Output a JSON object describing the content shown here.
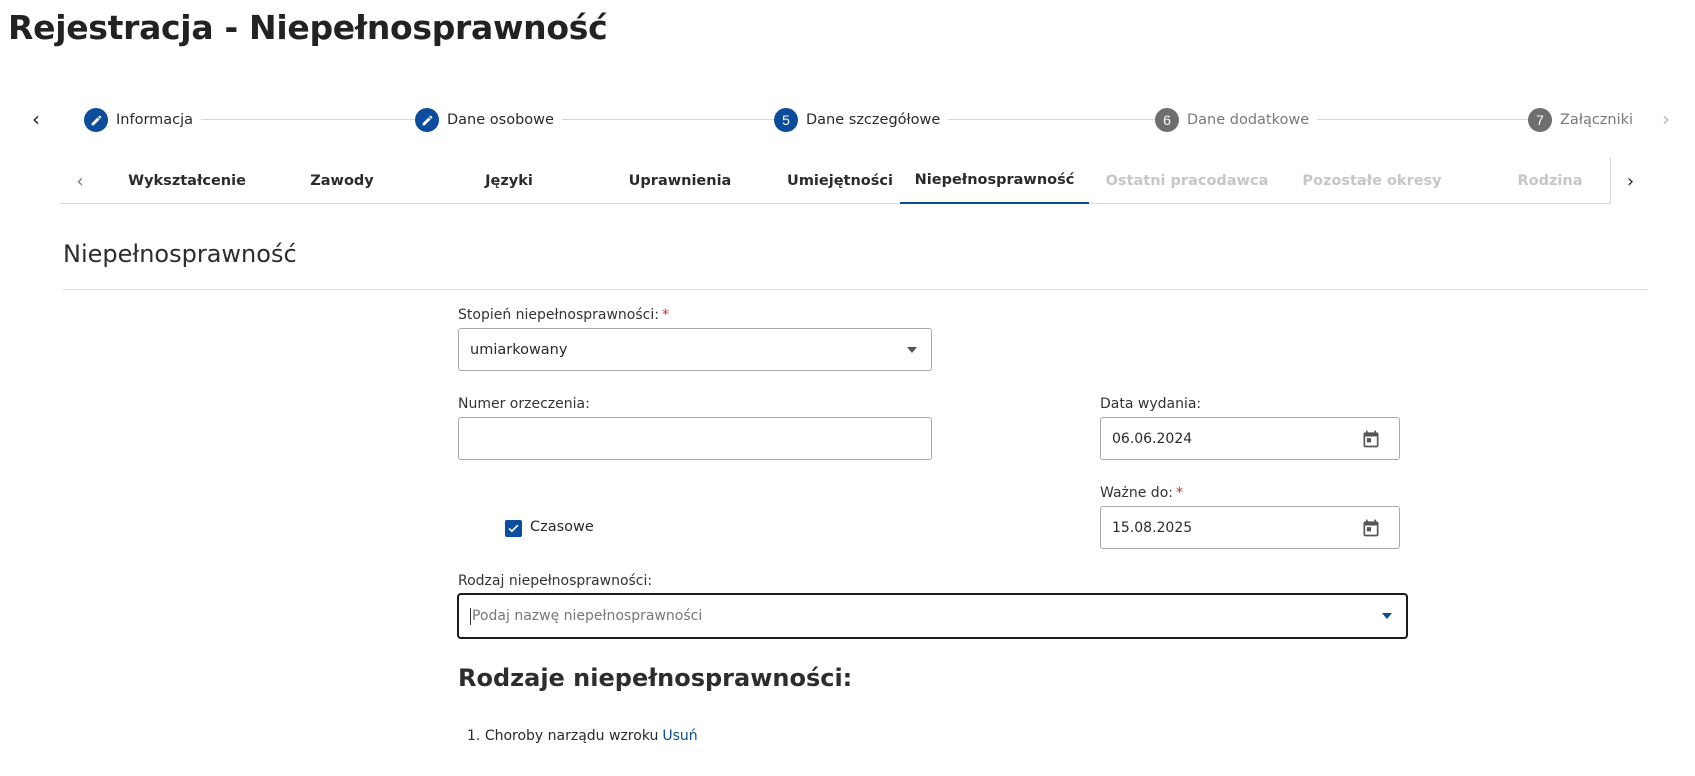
{
  "page": {
    "title": "Rejestracja - Niepełnosprawność"
  },
  "stepper": {
    "steps": [
      {
        "marker": "pencil-icon",
        "label": "Informacja",
        "state": "completed"
      },
      {
        "marker": "pencil-icon",
        "label": "Dane osobowe",
        "state": "completed"
      },
      {
        "marker": "5",
        "label": "Dane szczegółowe",
        "state": "current"
      },
      {
        "marker": "6",
        "label": "Dane dodatkowe",
        "state": "upcoming"
      },
      {
        "marker": "7",
        "label": "Załączniki",
        "state": "upcoming"
      }
    ]
  },
  "tabs": {
    "items": [
      {
        "label": "Wykształcenie",
        "state": "enabled"
      },
      {
        "label": "Zawody",
        "state": "enabled"
      },
      {
        "label": "Języki",
        "state": "enabled"
      },
      {
        "label": "Uprawnienia",
        "state": "enabled"
      },
      {
        "label": "Umiejętności",
        "state": "enabled"
      },
      {
        "label": "Niepełnosprawność",
        "state": "selected"
      },
      {
        "label": "Ostatni pracodawca",
        "state": "disabled"
      },
      {
        "label": "Pozostałe okresy",
        "state": "disabled"
      },
      {
        "label": "Rodzina",
        "state": "disabled"
      }
    ]
  },
  "section": {
    "title": "Niepełnosprawność"
  },
  "form": {
    "degree": {
      "label": "Stopień niepełnosprawności:",
      "required_mark": "*",
      "value": "umiarkowany"
    },
    "decision_number": {
      "label": "Numer orzeczenia:",
      "value": ""
    },
    "issue_date": {
      "label": "Data wydania:",
      "value": "06.06.2024"
    },
    "valid_until": {
      "label": "Ważne do:",
      "required_mark": "*",
      "value": "15.08.2025"
    },
    "temporary": {
      "label": "Czasowe",
      "checked": true
    },
    "disability_type": {
      "label": "Rodzaj niepełnosprawności:",
      "placeholder": "Podaj nazwę niepełnosprawności"
    }
  },
  "types_list": {
    "title": "Rodzaje niepełnosprawności:",
    "items": [
      {
        "number": "1.",
        "name": "Choroby narządu wzroku",
        "remove_label": "Usuń"
      }
    ]
  },
  "colors": {
    "accent": "#0b4c9c",
    "required": "#d62b2b",
    "inactive_step": "#6e6e6e",
    "disabled_tab": "#c6c6c6"
  }
}
